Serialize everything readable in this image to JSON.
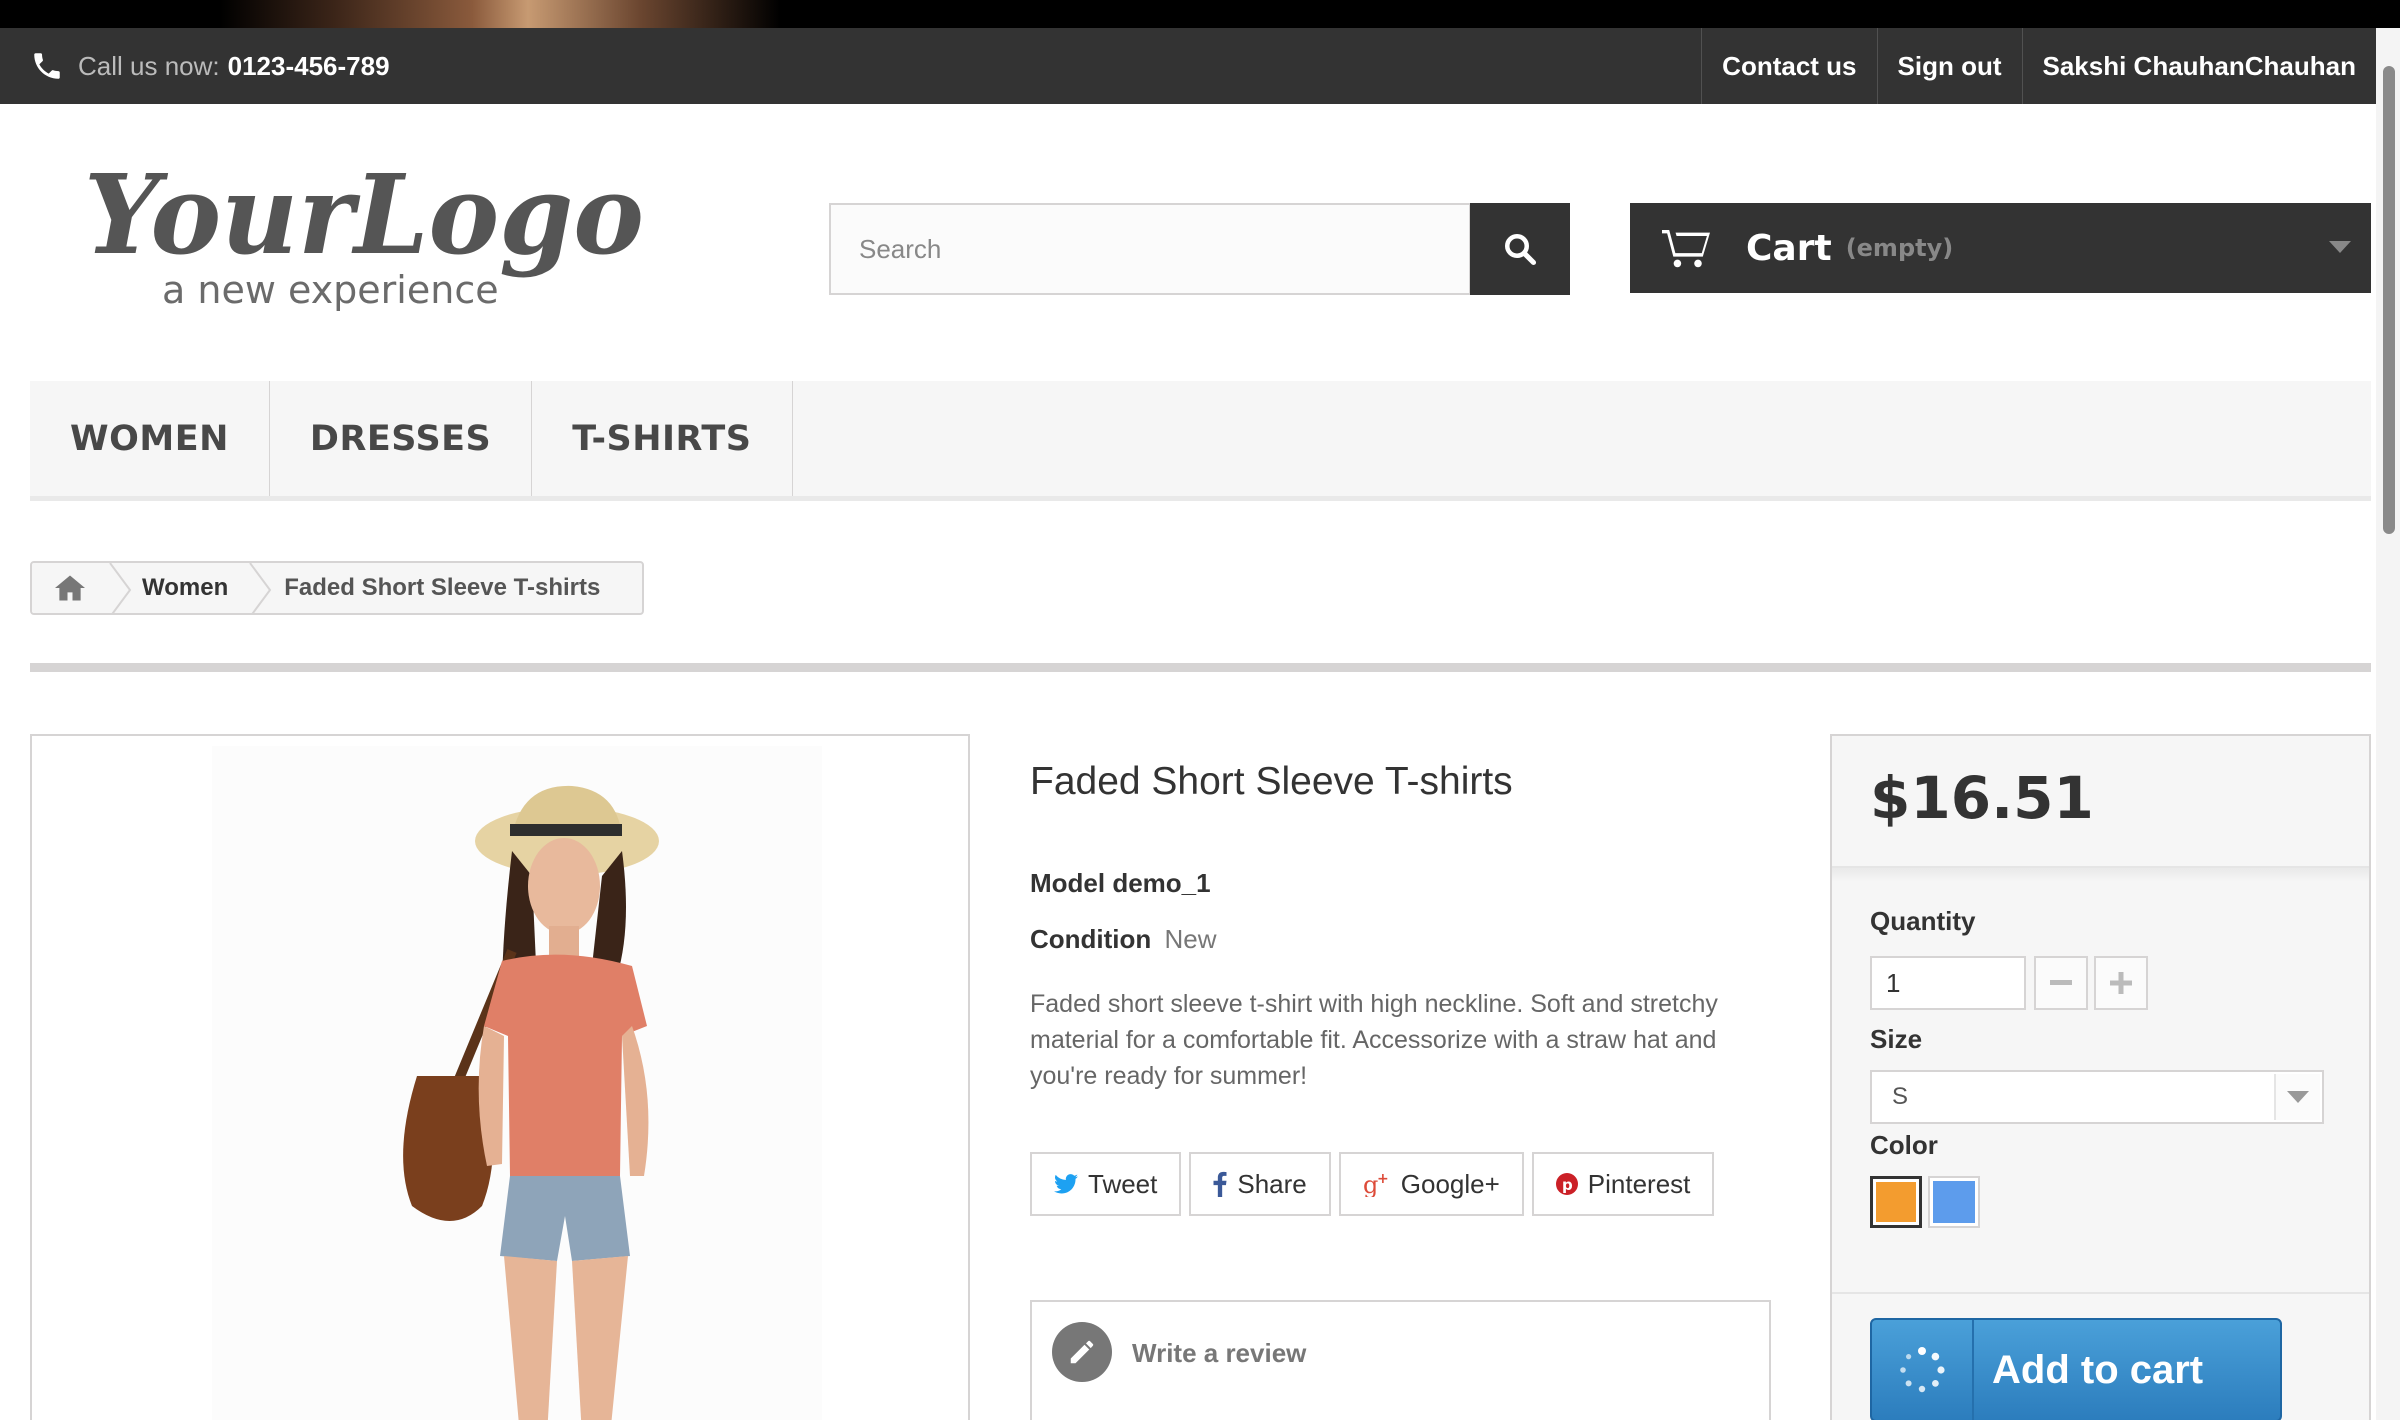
{
  "topbar": {
    "call_prefix": "Call us now:",
    "phone": "0123-456-789",
    "contact": "Contact us",
    "signout": "Sign out",
    "user": "Sakshi ChauhanChauhan"
  },
  "logo": {
    "main": "YourLogo",
    "tagline": "a new experience"
  },
  "search": {
    "placeholder": "Search"
  },
  "cart": {
    "label": "Cart",
    "status": "(empty)"
  },
  "menu": [
    "WOMEN",
    "DRESSES",
    "T-SHIRTS"
  ],
  "breadcrumb": {
    "category": "Women",
    "current": "Faded Short Sleeve T-shirts"
  },
  "product": {
    "title": "Faded Short Sleeve T-shirts",
    "model": "Model demo_1",
    "condition_label": "Condition",
    "condition_value": "New",
    "description": "Faded short sleeve t-shirt with high neckline. Soft and stretchy material for a comfortable fit. Accessorize with a straw hat and you're ready for summer!",
    "social": {
      "tweet": "Tweet",
      "share": "Share",
      "google": "Google+",
      "pinterest": "Pinterest"
    },
    "review": "Write a review"
  },
  "buy": {
    "price": "$16.51",
    "quantity_label": "Quantity",
    "quantity_value": "1",
    "size_label": "Size",
    "size_value": "S",
    "color_label": "Color",
    "colors": [
      "#f39c2f",
      "#5d9cec"
    ],
    "add_to_cart": "Add to cart"
  },
  "colors": {
    "dark_bar": "#333333",
    "accent_blue": "#2c7dbd",
    "border": "#d6d4d4"
  }
}
